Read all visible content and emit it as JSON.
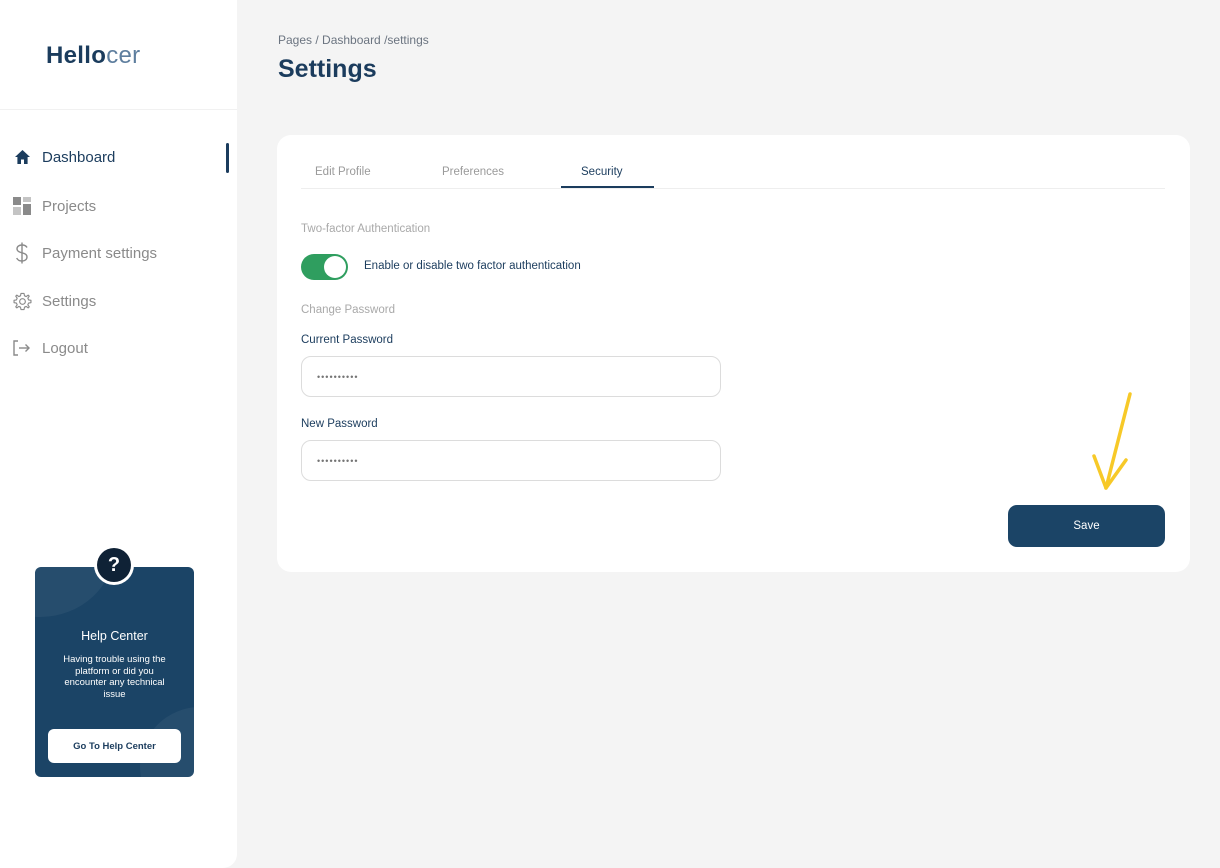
{
  "brand": {
    "bold": "Hello",
    "light": "cer"
  },
  "sidebar": {
    "items": [
      {
        "label": "Dashboard",
        "icon": "home-icon"
      },
      {
        "label": "Projects",
        "icon": "grid-icon"
      },
      {
        "label": "Payment settings",
        "icon": "dollar-icon"
      },
      {
        "label": "Settings",
        "icon": "gear-icon"
      },
      {
        "label": "Logout",
        "icon": "logout-icon"
      }
    ],
    "active_index": 0
  },
  "help_center": {
    "badge": "?",
    "title": "Help Center",
    "text": "Having trouble using the platform or did you encounter any technical issue",
    "button_label": "Go To Help Center"
  },
  "header": {
    "breadcrumb": "Pages / Dashboard /settings",
    "title": "Settings"
  },
  "tabs": [
    {
      "label": "Edit Profile"
    },
    {
      "label": "Preferences"
    },
    {
      "label": "Security"
    }
  ],
  "active_tab": 2,
  "security": {
    "two_factor_heading": "Two-factor Authentication",
    "two_factor_toggle_label": "Enable or disable two factor authentication",
    "two_factor_enabled": true,
    "change_password_heading": "Change Password",
    "current_password_label": "Current Password",
    "current_password_placeholder": "••••••••••",
    "new_password_label": "New Password",
    "new_password_placeholder": "••••••••••",
    "save_label": "Save"
  },
  "colors": {
    "primary": "#1b4466",
    "toggle_on": "#2f9e5f",
    "arrow": "#f7c928",
    "background": "#f4f4f4"
  }
}
